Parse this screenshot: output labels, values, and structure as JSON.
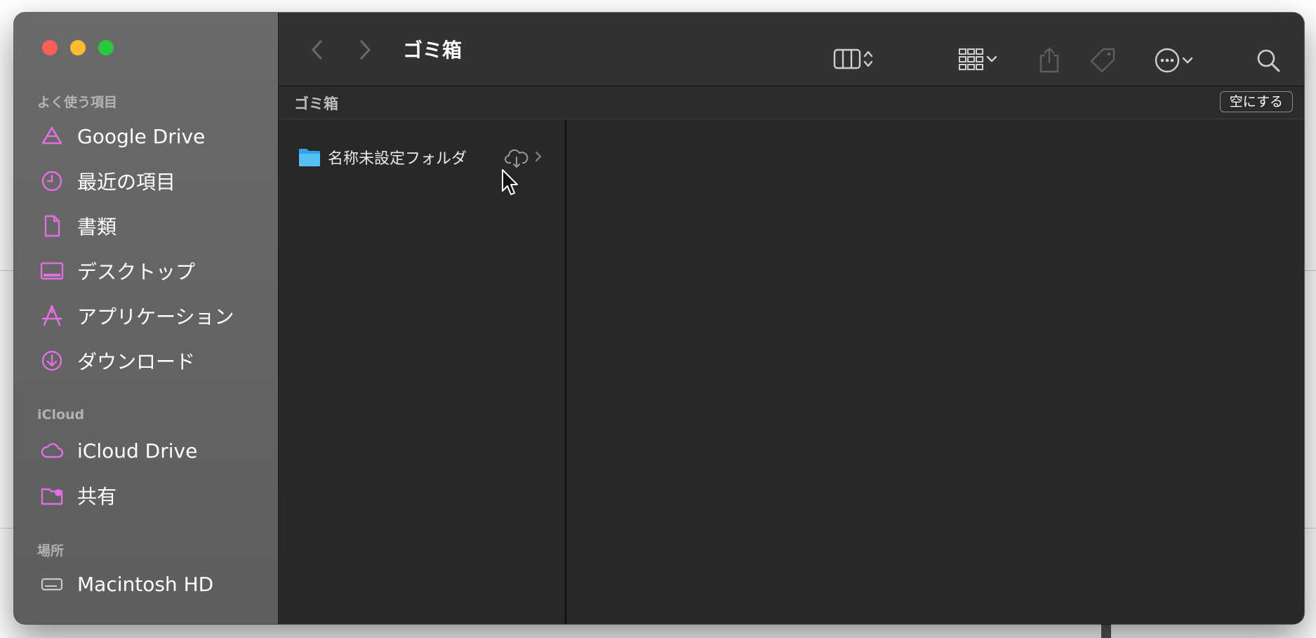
{
  "window": {
    "title": "ゴミ箱"
  },
  "sidebar": {
    "sections": [
      {
        "label": "よく使う項目",
        "items": [
          {
            "label": "Google Drive",
            "icon": "google-drive-icon"
          },
          {
            "label": "最近の項目",
            "icon": "clock-icon"
          },
          {
            "label": "書類",
            "icon": "document-icon"
          },
          {
            "label": "デスクトップ",
            "icon": "desktop-icon"
          },
          {
            "label": "アプリケーション",
            "icon": "applications-icon"
          },
          {
            "label": "ダウンロード",
            "icon": "download-icon"
          }
        ]
      },
      {
        "label": "iCloud",
        "items": [
          {
            "label": "iCloud Drive",
            "icon": "cloud-icon"
          },
          {
            "label": "共有",
            "icon": "shared-folder-icon"
          }
        ]
      },
      {
        "label": "場所",
        "items": [
          {
            "label": "Macintosh HD",
            "icon": "hard-drive-icon"
          }
        ]
      }
    ]
  },
  "pathbar": {
    "title": "ゴミ箱",
    "empty_button": "空にする"
  },
  "files": [
    {
      "name": "名称未設定フォルダ",
      "icon": "folder-icon",
      "status_icon": "cloud-download-icon"
    }
  ],
  "colors": {
    "sidebar_icon_accent": "#e070e0",
    "folder_blue": "#3fb0f0",
    "close": "#fe5f57",
    "minimize": "#febc2e",
    "maximize": "#28c840"
  }
}
